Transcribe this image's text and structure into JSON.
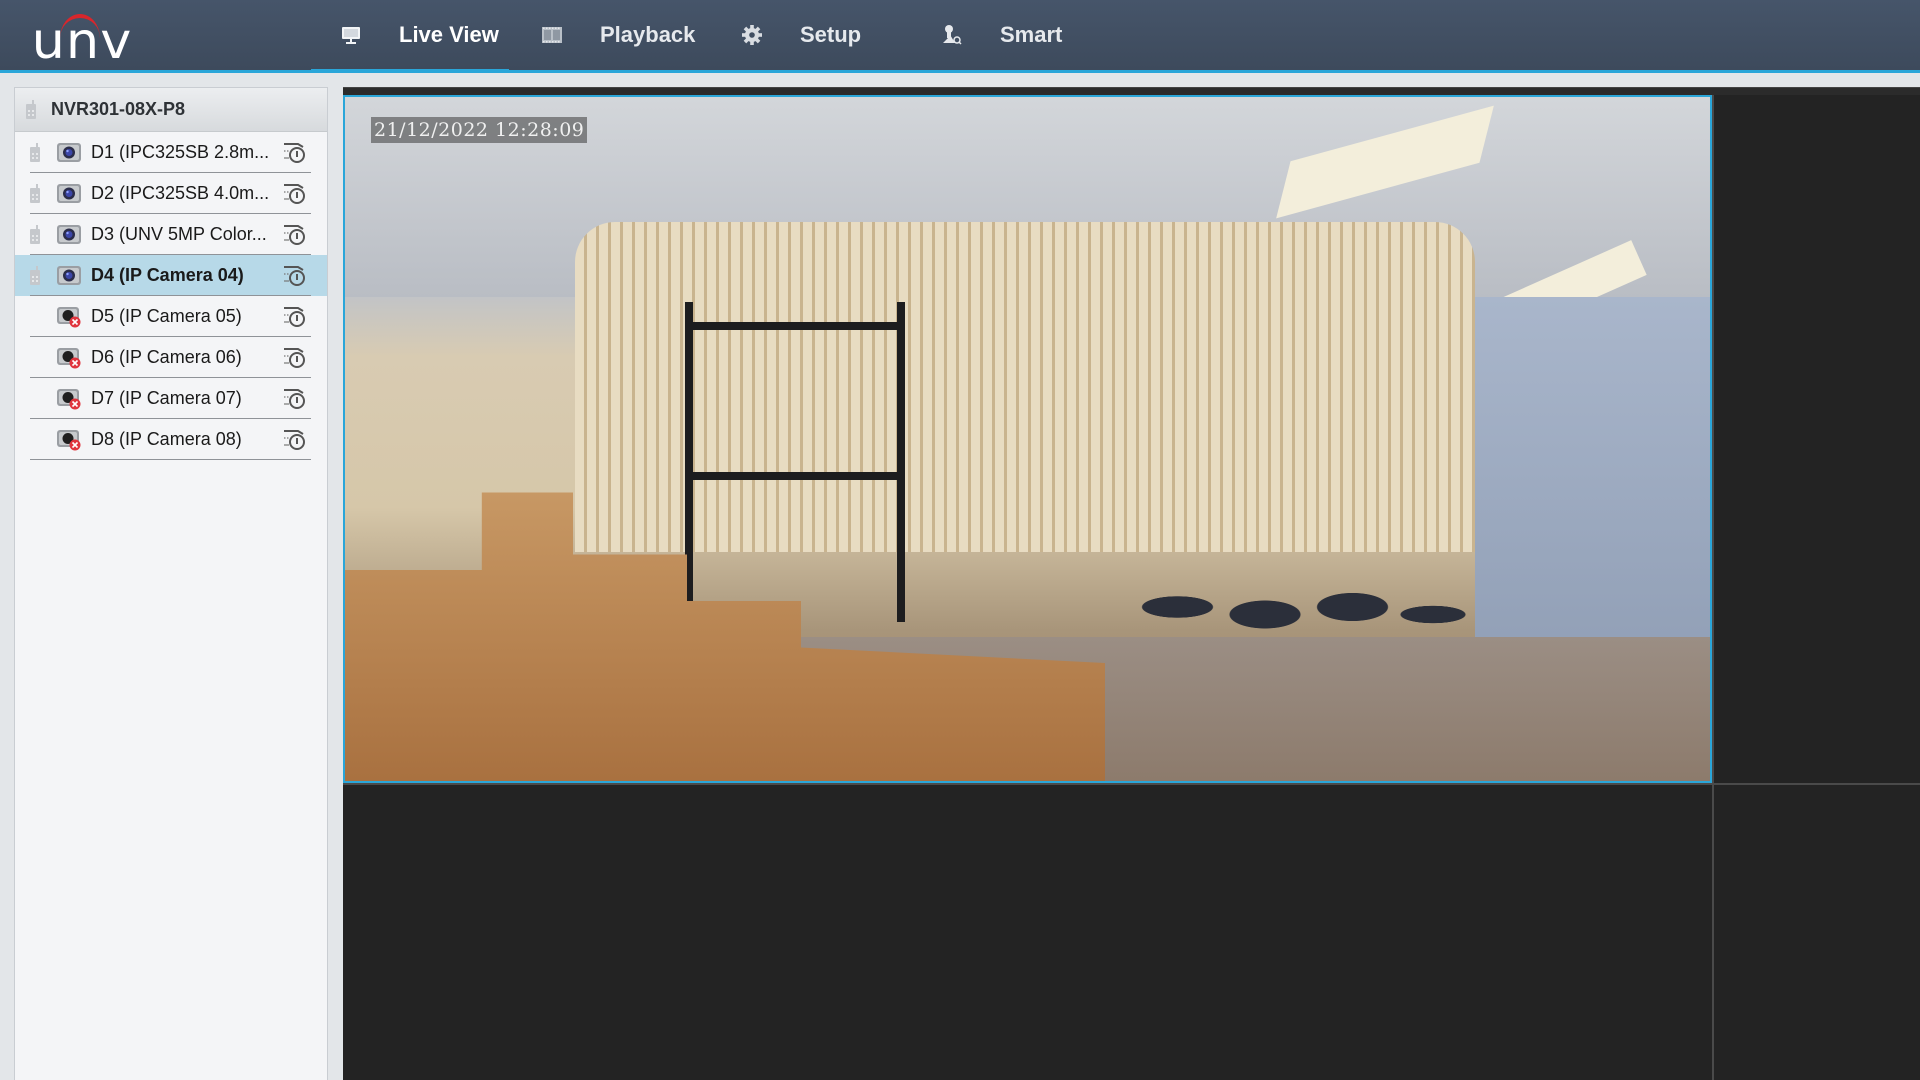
{
  "app": {
    "logo_text": "unv",
    "colors": {
      "accent": "#2aa6d9",
      "header_bg": "#414f62",
      "logo_arc": "#d9262c",
      "selected_row": "#b7d9e8",
      "offline_badge": "#e0353e"
    }
  },
  "nav": {
    "items": [
      {
        "label": "Live View",
        "icon": "monitor-icon",
        "active": true
      },
      {
        "label": "Playback",
        "icon": "film-icon",
        "active": false
      },
      {
        "label": "Setup",
        "icon": "gear-icon",
        "active": false
      },
      {
        "label": "Smart",
        "icon": "person-search-icon",
        "active": false
      }
    ]
  },
  "sidebar": {
    "root": {
      "label": "NVR301-08X-P8",
      "icon": "nvr-device-icon"
    },
    "channels": [
      {
        "label": "D1 (IPC325SB 2.8m...",
        "status": "online",
        "selected": false
      },
      {
        "label": "D2 (IPC325SB 4.0m...",
        "status": "online",
        "selected": false
      },
      {
        "label": "D3 (UNV 5MP Color...",
        "status": "online",
        "selected": false
      },
      {
        "label": "D4 (IP Camera 04)",
        "status": "online",
        "selected": true
      },
      {
        "label": "D5 (IP Camera 05)",
        "status": "offline",
        "selected": false
      },
      {
        "label": "D6 (IP Camera 06)",
        "status": "offline",
        "selected": false
      },
      {
        "label": "D7 (IP Camera 07)",
        "status": "offline",
        "selected": false
      },
      {
        "label": "D8 (IP Camera 08)",
        "status": "offline",
        "selected": false
      }
    ]
  },
  "live_view": {
    "layout": "2x2",
    "tiles": [
      {
        "channel": "D4 (IP Camera 04)",
        "osd_timestamp": "21/12/2022 12:28:09",
        "active": true
      },
      {
        "channel": "",
        "osd_timestamp": "",
        "active": false
      },
      {
        "channel": "",
        "osd_timestamp": "",
        "active": false
      },
      {
        "channel": "",
        "osd_timestamp": "",
        "active": false
      }
    ]
  }
}
